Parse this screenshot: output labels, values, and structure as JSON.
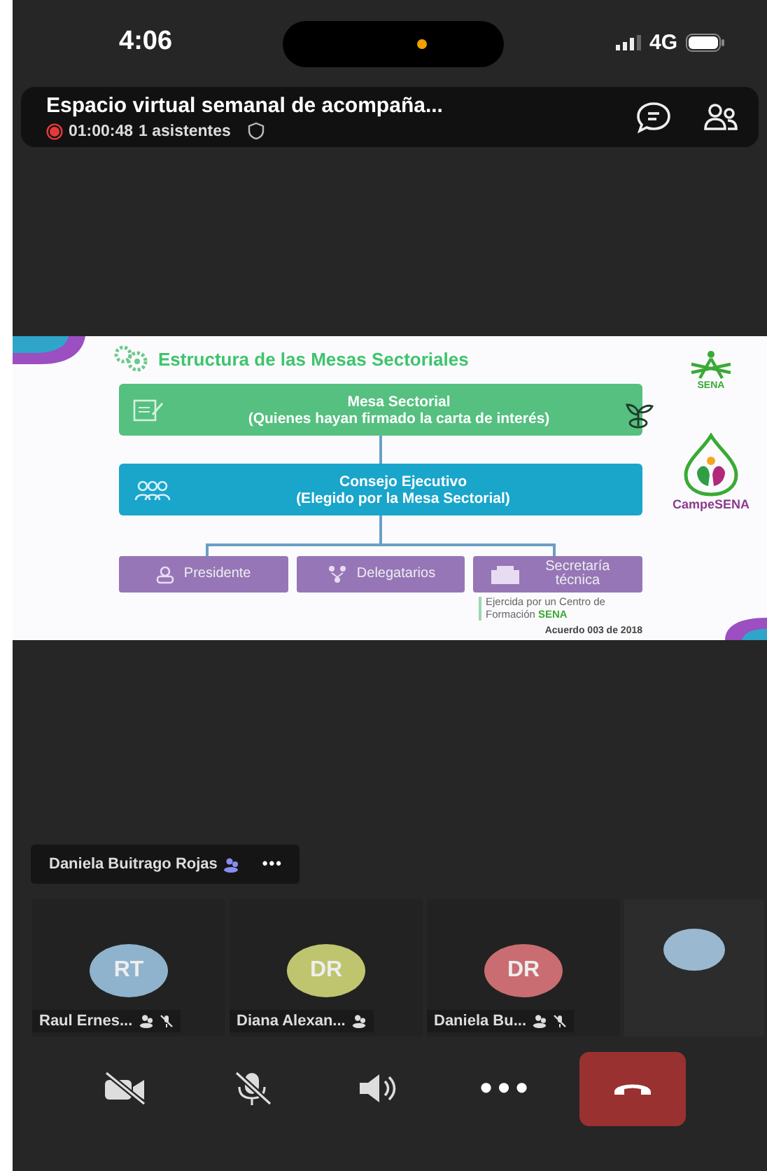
{
  "status_bar": {
    "time": "4:06",
    "network": "4G"
  },
  "meeting": {
    "title": "Espacio virtual semanal de acompaña...",
    "recording": true,
    "elapsed": "01:00:48",
    "attendees": "1 asistentes"
  },
  "slide": {
    "title": "Estructura de las Mesas Sectoriales",
    "levels": [
      {
        "kind": "sectorial",
        "title": "Mesa Sectorial",
        "subtitle": "(Quienes hayan firmado la carta de interés)"
      },
      {
        "kind": "council",
        "title": "Consejo Ejecutivo",
        "subtitle": "(Elegido por la Mesa Sectorial)"
      }
    ],
    "roles": [
      {
        "kind": "person",
        "label": "Presidente"
      },
      {
        "kind": "group",
        "label": "Delegatarios"
      },
      {
        "kind": "building",
        "label": "Secretaría técnica"
      }
    ],
    "note": "Ejercida por un Centro de Formación **SENA**",
    "footer": "Acuerdo 003 de 2018",
    "logos": [
      {
        "kind": "sena",
        "label": "SENA"
      },
      {
        "kind": "campesena",
        "label": "CampeSENA"
      }
    ]
  },
  "speaker": {
    "name": "Daniela Buitrago Rojas",
    "more": "•••"
  },
  "participants": [
    {
      "initials": "RT",
      "color": "#8fb3cc",
      "name": "Raul Ernes...",
      "muted": true
    },
    {
      "initials": "DR",
      "color": "#bfc56e",
      "name": "Diana Alexan...",
      "muted": false
    },
    {
      "initials": "DR",
      "color": "#c96d72",
      "name": "Daniela Bu...",
      "muted": true
    },
    {
      "color": "#9ab9d1"
    }
  ],
  "controls": [
    {
      "kind": "camera",
      "on": false
    },
    {
      "kind": "mic",
      "on": false
    },
    {
      "kind": "speaker"
    },
    {
      "kind": "more",
      "label": "•••"
    },
    {
      "kind": "end_call"
    }
  ]
}
